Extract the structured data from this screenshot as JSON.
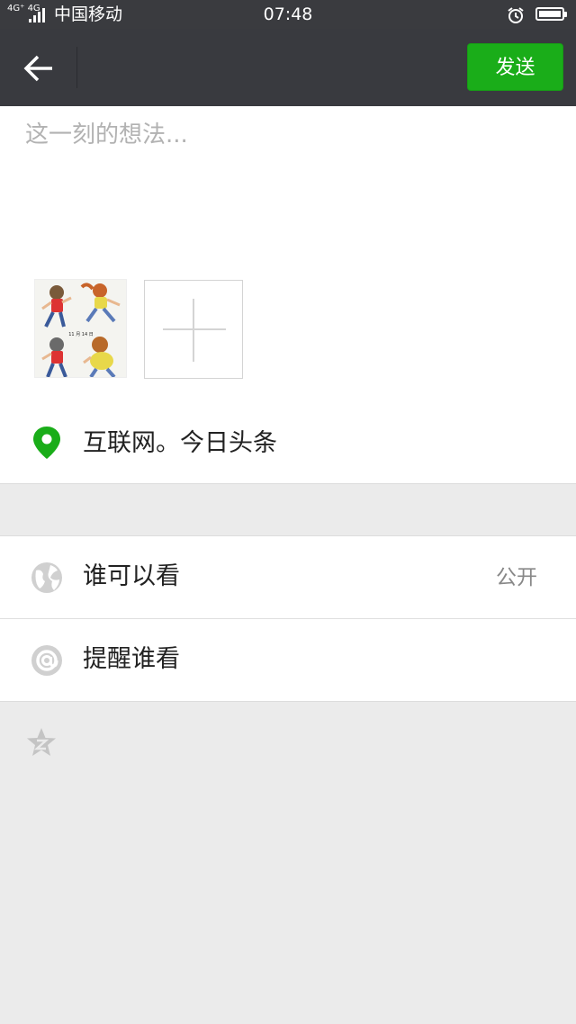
{
  "status_bar": {
    "network": "4G⁺ 4G",
    "carrier": "中国移动",
    "time": "07:48"
  },
  "header": {
    "send_label": "发送"
  },
  "compose": {
    "placeholder": "这一刻的想法...",
    "images": [
      {
        "thumb_label": "11 月 14 日"
      }
    ]
  },
  "location": {
    "text": "互联网。今日头条"
  },
  "options": {
    "visibility_label": "谁可以看",
    "visibility_value": "公开",
    "remind_label": "提醒谁看"
  },
  "colors": {
    "accent": "#1aad19",
    "header_bg": "#393a3f",
    "page_bg": "#ebebeb"
  }
}
